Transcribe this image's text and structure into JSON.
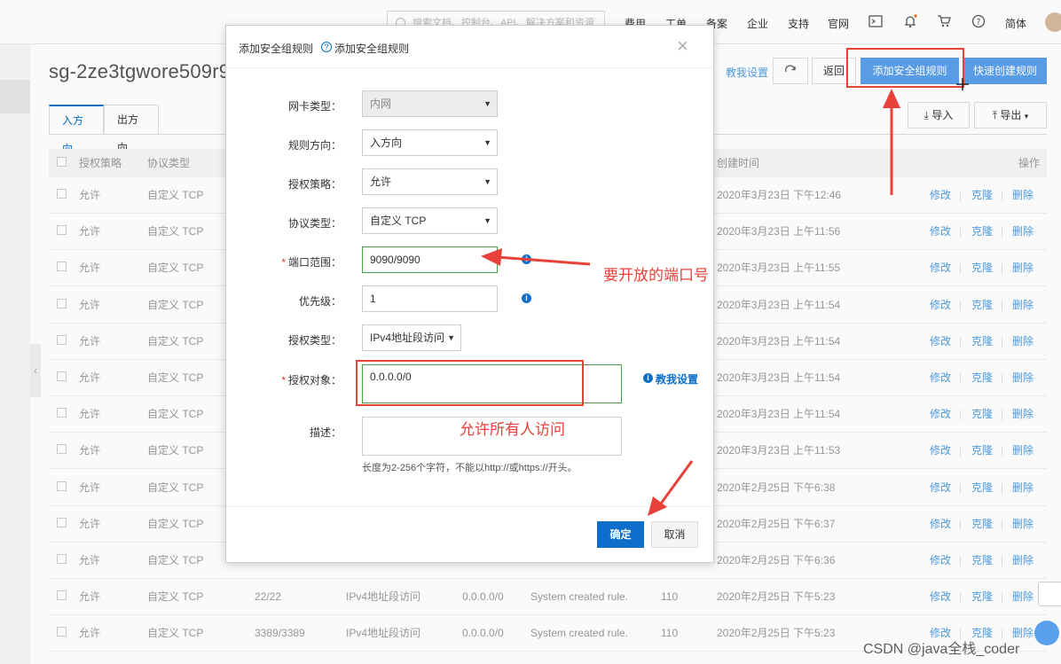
{
  "topbar": {
    "search_placeholder": "搜索文档、控制台、API、解决方案和资源",
    "nav": [
      "费用",
      "工单",
      "备案",
      "企业",
      "支持",
      "官网"
    ],
    "lang": "简体"
  },
  "page": {
    "title": "sg-2ze3tgwore509r9",
    "tabs": [
      "入方向",
      "出方向"
    ],
    "actions": {
      "teach": "教我设置",
      "back": "返回",
      "add_rule": "添加安全组规则",
      "quick_rule": "快速创建规则",
      "import": "导入",
      "export": "导出"
    }
  },
  "table": {
    "headers": {
      "policy": "授权策略",
      "protocol": "协议类型",
      "created": "创建时间",
      "ops": "操作"
    },
    "op_labels": {
      "edit": "修改",
      "clone": "克隆",
      "delete": "删除"
    },
    "rows": [
      {
        "policy": "允许",
        "protocol": "自定义 TCP",
        "port": "",
        "auth_type": "",
        "auth_obj": "",
        "desc": "",
        "priority": "",
        "created": "2020年3月23日 下午12:46"
      },
      {
        "policy": "允许",
        "protocol": "自定义 TCP",
        "port": "",
        "auth_type": "",
        "auth_obj": "",
        "desc": "",
        "priority": "",
        "created": "2020年3月23日 上午11:56"
      },
      {
        "policy": "允许",
        "protocol": "自定义 TCP",
        "port": "",
        "auth_type": "",
        "auth_obj": "",
        "desc": "",
        "priority": "",
        "created": "2020年3月23日 上午11:55"
      },
      {
        "policy": "允许",
        "protocol": "自定义 TCP",
        "port": "",
        "auth_type": "",
        "auth_obj": "",
        "desc": "",
        "priority": "",
        "created": "2020年3月23日 上午11:54"
      },
      {
        "policy": "允许",
        "protocol": "自定义 TCP",
        "port": "",
        "auth_type": "",
        "auth_obj": "",
        "desc": "",
        "priority": "",
        "created": "2020年3月23日 上午11:54"
      },
      {
        "policy": "允许",
        "protocol": "自定义 TCP",
        "port": "",
        "auth_type": "",
        "auth_obj": "",
        "desc": "",
        "priority": "",
        "created": "2020年3月23日 上午11:54"
      },
      {
        "policy": "允许",
        "protocol": "自定义 TCP",
        "port": "",
        "auth_type": "",
        "auth_obj": "",
        "desc": "",
        "priority": "",
        "created": "2020年3月23日 上午11:54"
      },
      {
        "policy": "允许",
        "protocol": "自定义 TCP",
        "port": "",
        "auth_type": "",
        "auth_obj": "",
        "desc": "",
        "priority": "",
        "created": "2020年3月23日 上午11:53"
      },
      {
        "policy": "允许",
        "protocol": "自定义 TCP",
        "port": "",
        "auth_type": "",
        "auth_obj": "",
        "desc": "",
        "priority": "",
        "created": "2020年2月25日 下午6:38"
      },
      {
        "policy": "允许",
        "protocol": "自定义 TCP",
        "port": "",
        "auth_type": "",
        "auth_obj": "",
        "desc": "",
        "priority": "",
        "created": "2020年2月25日 下午6:37"
      },
      {
        "policy": "允许",
        "protocol": "自定义 TCP",
        "port": "",
        "auth_type": "",
        "auth_obj": "",
        "desc": "",
        "priority": "",
        "created": "2020年2月25日 下午6:36"
      },
      {
        "policy": "允许",
        "protocol": "自定义 TCP",
        "port": "22/22",
        "auth_type": "IPv4地址段访问",
        "auth_obj": "0.0.0.0/0",
        "desc": "System created rule.",
        "priority": "110",
        "created": "2020年2月25日 下午5:23"
      },
      {
        "policy": "允许",
        "protocol": "自定义 TCP",
        "port": "3389/3389",
        "auth_type": "IPv4地址段访问",
        "auth_obj": "0.0.0.0/0",
        "desc": "System created rule.",
        "priority": "110",
        "created": "2020年2月25日 下午5:23"
      }
    ]
  },
  "modal": {
    "title": "添加安全组规则",
    "help_link": "添加安全组规则",
    "fields": {
      "nic_type": {
        "label": "网卡类型：",
        "value": "内网"
      },
      "direction": {
        "label": "规则方向：",
        "value": "入方向"
      },
      "policy": {
        "label": "授权策略：",
        "value": "允许"
      },
      "protocol": {
        "label": "协议类型：",
        "value": "自定义 TCP"
      },
      "port": {
        "label": "端口范围：",
        "value": "9090/9090"
      },
      "priority": {
        "label": "优先级：",
        "value": "1"
      },
      "auth_type": {
        "label": "授权类型：",
        "value": "IPv4地址段访问"
      },
      "auth_obj": {
        "label": "授权对象：",
        "value": "0.0.0.0/0"
      },
      "desc": {
        "label": "描述：",
        "value": ""
      }
    },
    "teach_link": "教我设置",
    "hint": "长度为2-256个字符，不能以http://或https://开头。",
    "ok": "确定",
    "cancel": "取消"
  },
  "annotations": {
    "port_note": "要开放的端口号",
    "auth_note": "允许所有人访问"
  },
  "watermark": "CSDN @java全栈_coder"
}
